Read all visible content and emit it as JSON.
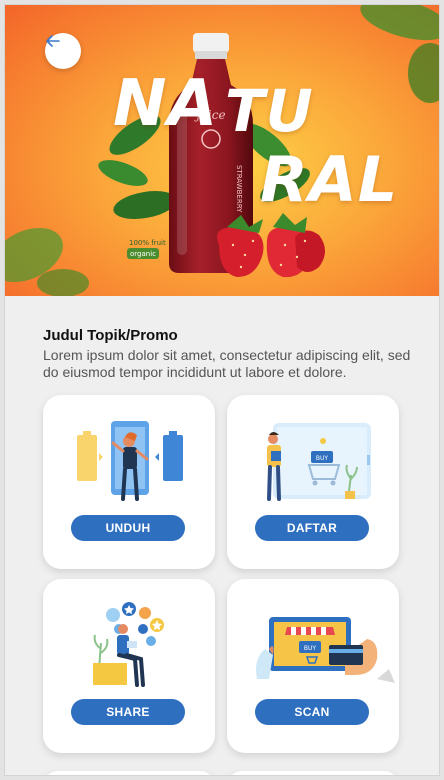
{
  "hero": {
    "headline": [
      "NA",
      "TU",
      "RAL"
    ],
    "bottle_label": "juice",
    "bottle_side_text": "STRAWBERRY",
    "badge_top": "100% fruit",
    "badge_bottom": "organic"
  },
  "promo": {
    "title": "Judul Topik/Promo",
    "description": "Lorem ipsum dolor sit amet, consectetur adipiscing elit, sed do eiusmod tempor incididunt ut labore et dolore."
  },
  "cards": [
    {
      "label": "UNDUH"
    },
    {
      "label": "DAFTAR",
      "illustration_text": "BUY"
    },
    {
      "label": "SHARE"
    },
    {
      "label": "SCAN",
      "illustration_text": "BUY"
    }
  ],
  "colors": {
    "accent": "#2f6fc0",
    "hero_orange": "#f6832a",
    "hero_yellow": "#fdc043"
  }
}
